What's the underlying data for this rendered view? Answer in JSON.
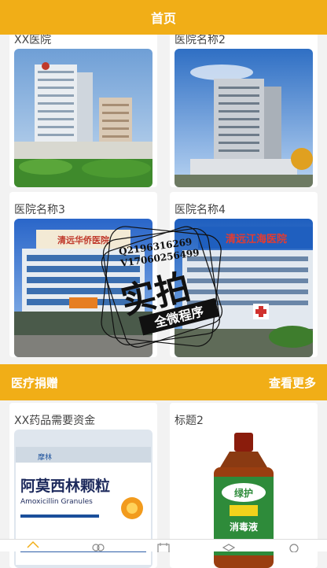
{
  "header": {
    "title": "首页"
  },
  "hospitals": [
    {
      "name": "XX医院"
    },
    {
      "name": "医院名称2"
    },
    {
      "name": "医院名称3"
    },
    {
      "name": "医院名称4"
    }
  ],
  "donation_section": {
    "title": "医疗捐赠",
    "more_label": "查看更多"
  },
  "donations": [
    {
      "title": "XX药品需要资金"
    },
    {
      "title": "标题2"
    }
  ],
  "image_text": {
    "hospital3_sign": "清远华侨医院",
    "hospital4_sign": "清远江海医院",
    "medicine_brand": "摩林",
    "medicine_name": "阿莫西林颗粒",
    "medicine_name_en": "Amoxicillin Granules",
    "disinfectant_brand": "绿护",
    "disinfectant_name": "消毒液"
  },
  "watermark": {
    "qq": "Q2196316269",
    "phone": "V17060256499",
    "big_text": "实拍",
    "ribbon": "全微程序"
  },
  "tabbar": {
    "icons": [
      "home-icon",
      "community-icon",
      "calendar-icon",
      "layers-icon",
      "search-icon"
    ]
  },
  "colors": {
    "accent": "#f1ae17",
    "text": "#444444",
    "background": "#f2f2f2"
  }
}
